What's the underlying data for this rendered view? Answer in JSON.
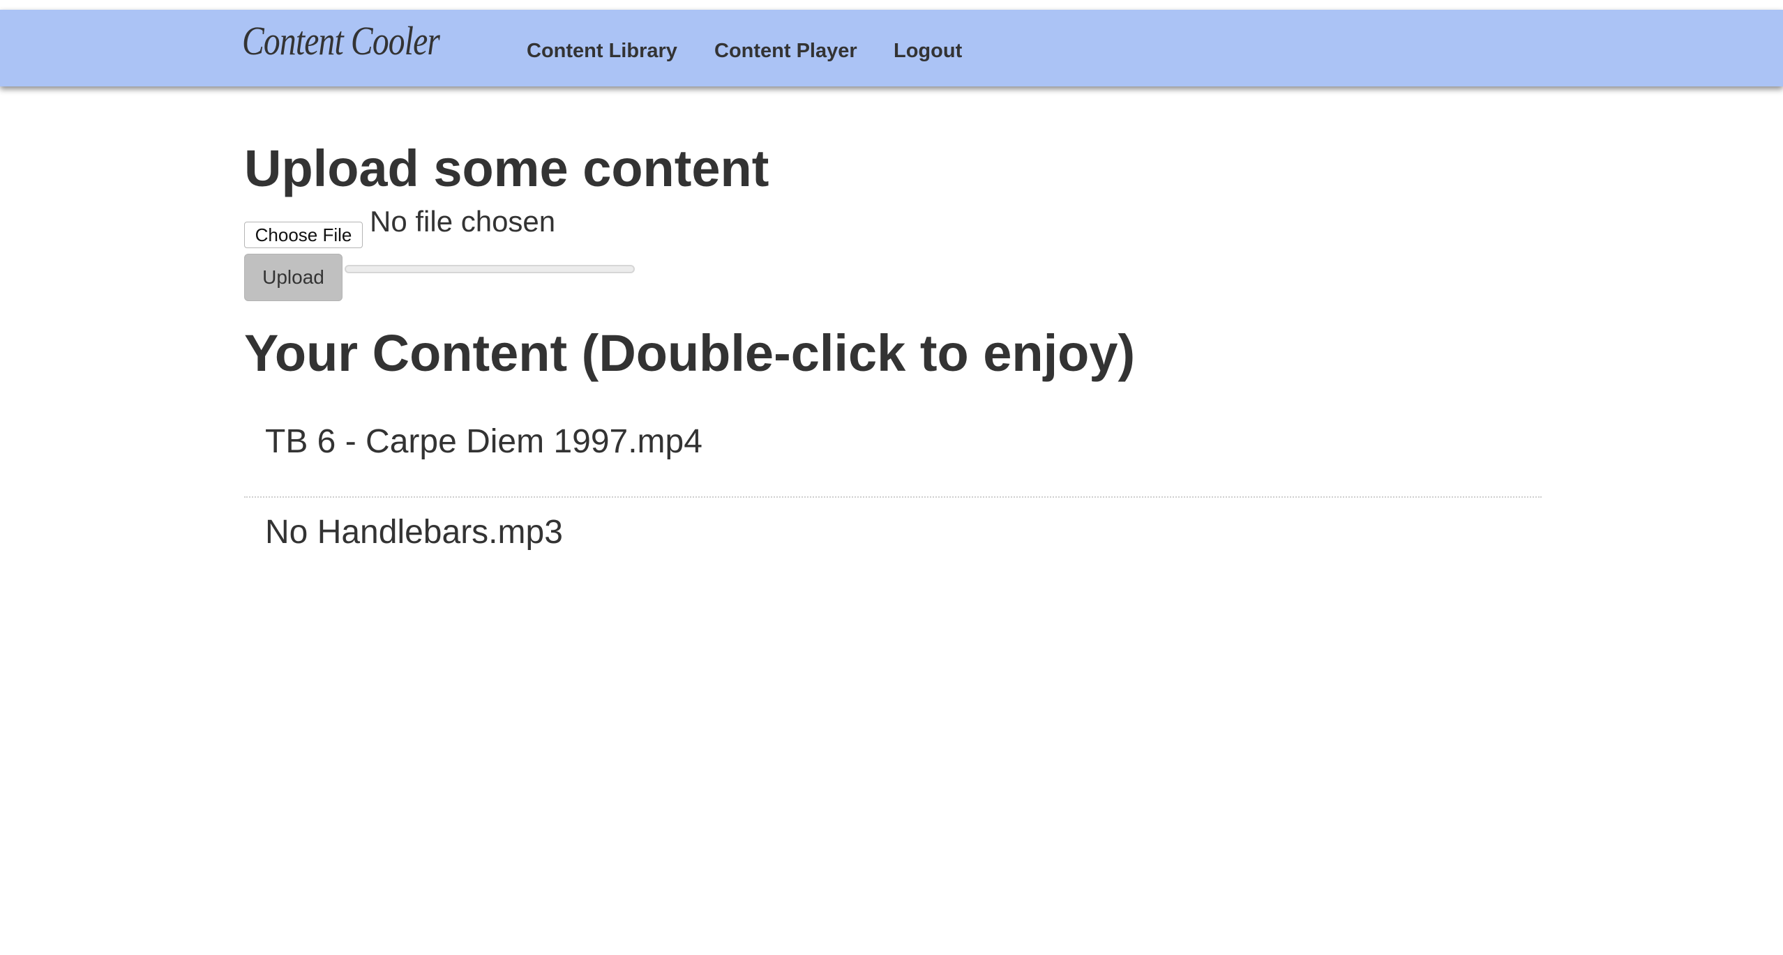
{
  "navbar": {
    "brand": "Content Cooler",
    "links": [
      {
        "label": "Content Library"
      },
      {
        "label": "Content Player"
      },
      {
        "label": "Logout"
      }
    ]
  },
  "upload": {
    "heading": "Upload some content",
    "choose_file_label": "Choose File",
    "file_status": "No file chosen",
    "upload_button_label": "Upload",
    "progress_percent": 0
  },
  "content": {
    "heading": "Your Content (Double-click to enjoy)",
    "items": [
      {
        "name": "TB 6 - Carpe Diem 1997.mp4"
      },
      {
        "name": "No Handlebars.mp3"
      }
    ]
  },
  "colors": {
    "navbar_background": "#abc3f5",
    "upload_button_background": "#c0c0c0",
    "text": "#333333"
  }
}
